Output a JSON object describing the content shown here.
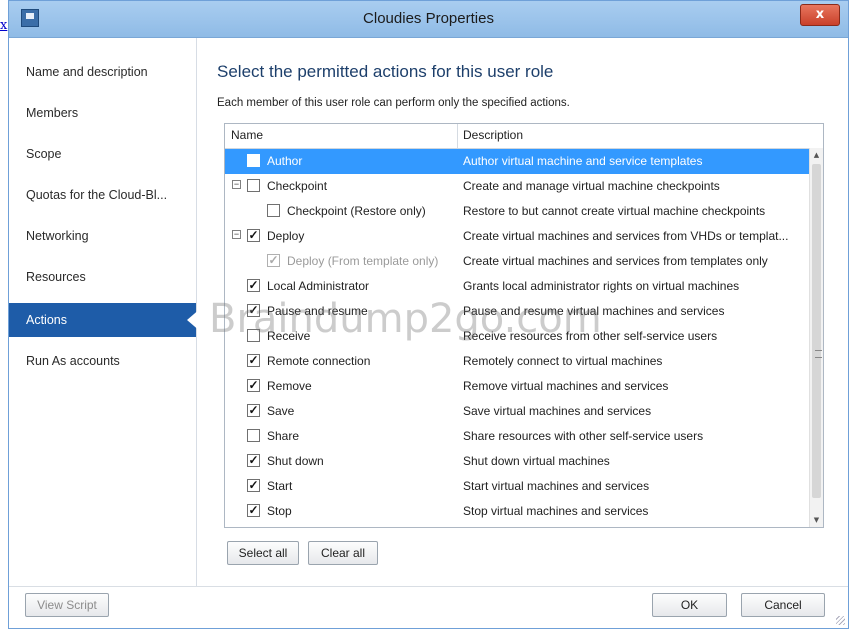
{
  "left_link": "x",
  "window": {
    "title": "Cloudies Properties",
    "close_label": "x"
  },
  "sidebar": {
    "items": [
      {
        "label": "Name and description"
      },
      {
        "label": "Members"
      },
      {
        "label": "Scope"
      },
      {
        "label": "Quotas for the Cloud-Bl..."
      },
      {
        "label": "Networking"
      },
      {
        "label": "Resources"
      },
      {
        "label": "Actions",
        "active": true
      },
      {
        "label": "Run As accounts"
      }
    ]
  },
  "main": {
    "heading": "Select the permitted actions for this user role",
    "subtext": "Each member of this user role can perform only the specified actions.",
    "columns": {
      "name": "Name",
      "description": "Description"
    },
    "rows": [
      {
        "name": "Author",
        "description": "Author virtual machine and service templates",
        "checked": false,
        "selected": true
      },
      {
        "name": "Checkpoint",
        "description": "Create and manage virtual machine checkpoints",
        "checked": false,
        "expander": "⊟"
      },
      {
        "name": "Checkpoint (Restore only)",
        "description": "Restore to but cannot create virtual machine checkpoints",
        "checked": false
      },
      {
        "name": "Deploy",
        "description": "Create virtual machines and services from VHDs or templat...",
        "checked": true,
        "expander": "⊟"
      },
      {
        "name": "Deploy (From template only)",
        "description": "Create virtual machines and services from templates only",
        "checked": true,
        "disabled": true
      },
      {
        "name": "Local Administrator",
        "description": "Grants local administrator rights on virtual machines",
        "checked": true
      },
      {
        "name": "Pause and resume",
        "description": "Pause and resume virtual machines and services",
        "checked": true
      },
      {
        "name": "Receive",
        "description": "Receive resources from other self-service users",
        "checked": false
      },
      {
        "name": "Remote connection",
        "description": "Remotely connect to virtual machines",
        "checked": true
      },
      {
        "name": "Remove",
        "description": "Remove virtual machines and services",
        "checked": true
      },
      {
        "name": "Save",
        "description": "Save virtual machines and services",
        "checked": true
      },
      {
        "name": "Share",
        "description": "Share resources with other self-service users",
        "checked": false
      },
      {
        "name": "Shut down",
        "description": "Shut down virtual machines",
        "checked": true
      },
      {
        "name": "Start",
        "description": "Start virtual machines and services",
        "checked": true
      },
      {
        "name": "Stop",
        "description": "Stop virtual machines and services",
        "checked": true
      }
    ],
    "select_all": "Select all",
    "clear_all": "Clear all"
  },
  "footer": {
    "view_script": "View Script",
    "ok": "OK",
    "cancel": "Cancel"
  },
  "watermark": "Braindump2go.com",
  "colors": {
    "selection": "#3399ff",
    "active_nav": "#1e5ca8",
    "titlebar": "#a9cdf0"
  }
}
